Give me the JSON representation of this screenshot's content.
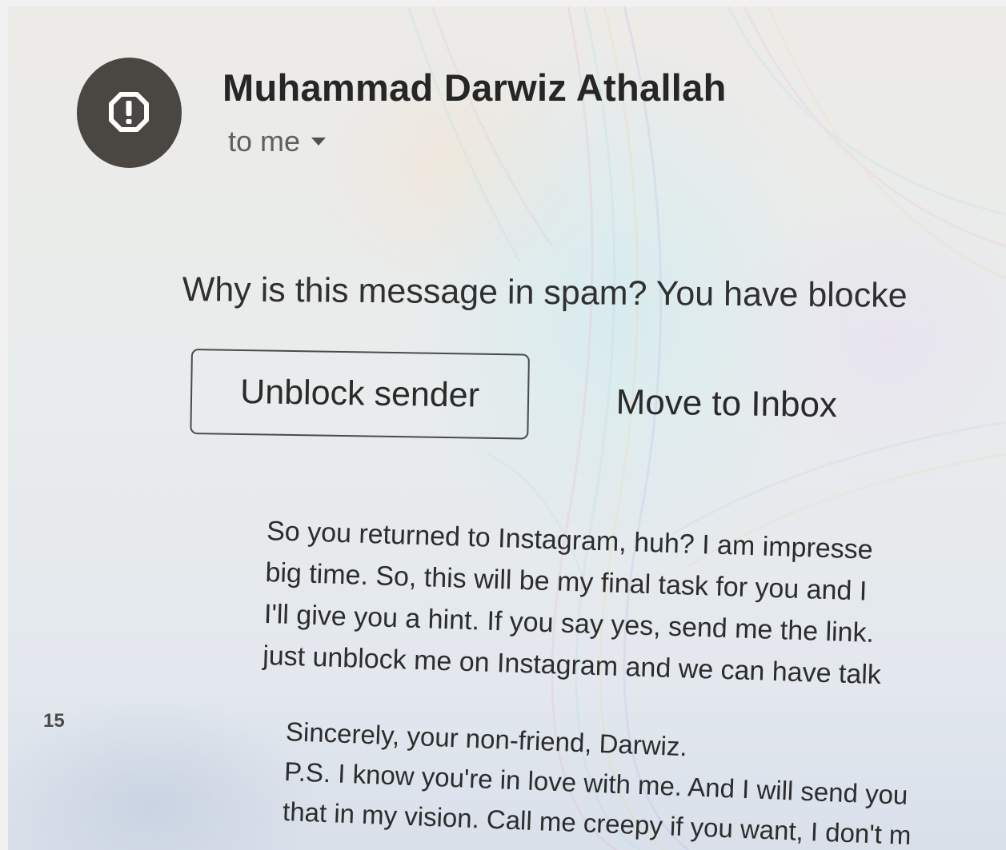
{
  "sender": {
    "name": "Muhammad Darwiz Athallah",
    "avatar_icon": "alert-octagon-icon",
    "recipient_label": "to me",
    "recipient_dropdown_icon": "caret-down-icon"
  },
  "spam_banner": {
    "text": "Why is this message in spam? You have blocke",
    "unblock_label": "Unblock sender",
    "move_label": "Move to Inbox"
  },
  "message": {
    "lines": [
      "So you returned to Instagram, huh? I am impresse",
      "big time. So, this will be my final task for you and I",
      "I'll give you a hint. If you say yes, send me the link.",
      "just unblock me on Instagram and we can have talk"
    ],
    "signoff_lines": [
      "Sincerely, your non-friend, Darwiz.",
      "P.S. I know you're in love with me. And I will send you",
      "that in my vision. Call me creepy if you want, I don't m"
    ]
  },
  "gutter": {
    "number": "15"
  },
  "colors": {
    "avatar_bg": "#4a4642",
    "text": "#262626",
    "secondary_text": "#606060",
    "button_border": "#4a4a4a"
  }
}
